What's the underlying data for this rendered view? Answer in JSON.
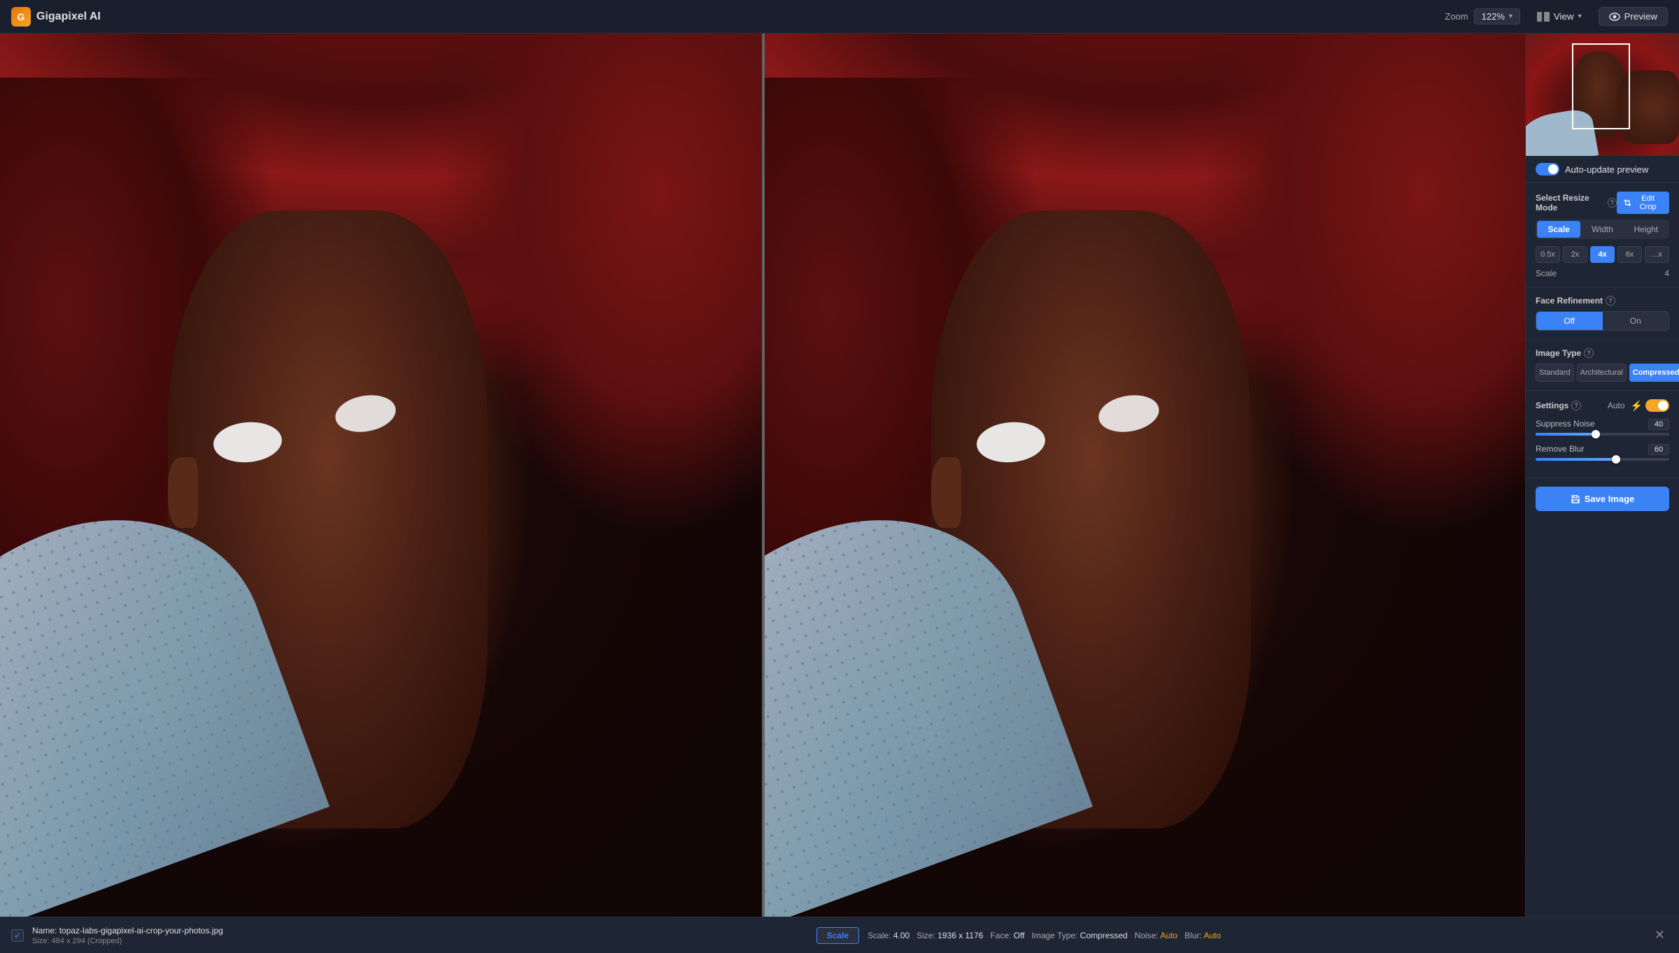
{
  "app": {
    "title": "Gigapixel AI",
    "logo_letter": "G"
  },
  "header": {
    "zoom_label": "Zoom",
    "zoom_value": "122%",
    "view_label": "View",
    "preview_label": "Preview"
  },
  "thumbnail": {
    "crop_visible": true
  },
  "auto_update": {
    "label": "Auto-update preview",
    "enabled": true
  },
  "resize_mode": {
    "label": "Select Resize Mode",
    "edit_crop_label": "Edit Crop",
    "tabs": [
      "Scale",
      "Width",
      "Height"
    ],
    "active_tab": "Scale"
  },
  "scale": {
    "options": [
      "0.5x",
      "2x",
      "4x",
      "6x",
      "...x"
    ],
    "active": "4x",
    "label": "Scale",
    "value": "4"
  },
  "face_refinement": {
    "label": "Face Refinement",
    "options": [
      "Off",
      "On"
    ],
    "active": "Off"
  },
  "image_type": {
    "label": "Image Type",
    "options": [
      "Standard",
      "Architectural",
      "Compressed"
    ],
    "active": "Compressed"
  },
  "settings": {
    "label": "Settings",
    "auto_label": "Auto",
    "lightning_on": true,
    "toggle_on": true
  },
  "suppress_noise": {
    "label": "Suppress Noise",
    "value": "40",
    "percent": 45
  },
  "remove_blur": {
    "label": "Remove Blur",
    "value": "60",
    "percent": 60
  },
  "save": {
    "label": "Save Image"
  },
  "bottom_bar": {
    "filename_label": "Name:",
    "filename": "topaz-labs-gigapixel-ai-crop-your-photos.jpg",
    "size_label": "Size:",
    "size": "484 x 294 (Cropped)",
    "scale_label": "Scale",
    "output_scale_label": "Scale:",
    "output_scale": "4.00",
    "output_size_label": "Size:",
    "output_size": "1936 x 1176",
    "face_label": "Face:",
    "face_value": "Off",
    "image_type_label": "Image Type:",
    "image_type_value": "Compressed",
    "noise_label": "Noise:",
    "noise_value": "Auto",
    "blur_label": "Blur:",
    "blur_value": "Auto"
  }
}
